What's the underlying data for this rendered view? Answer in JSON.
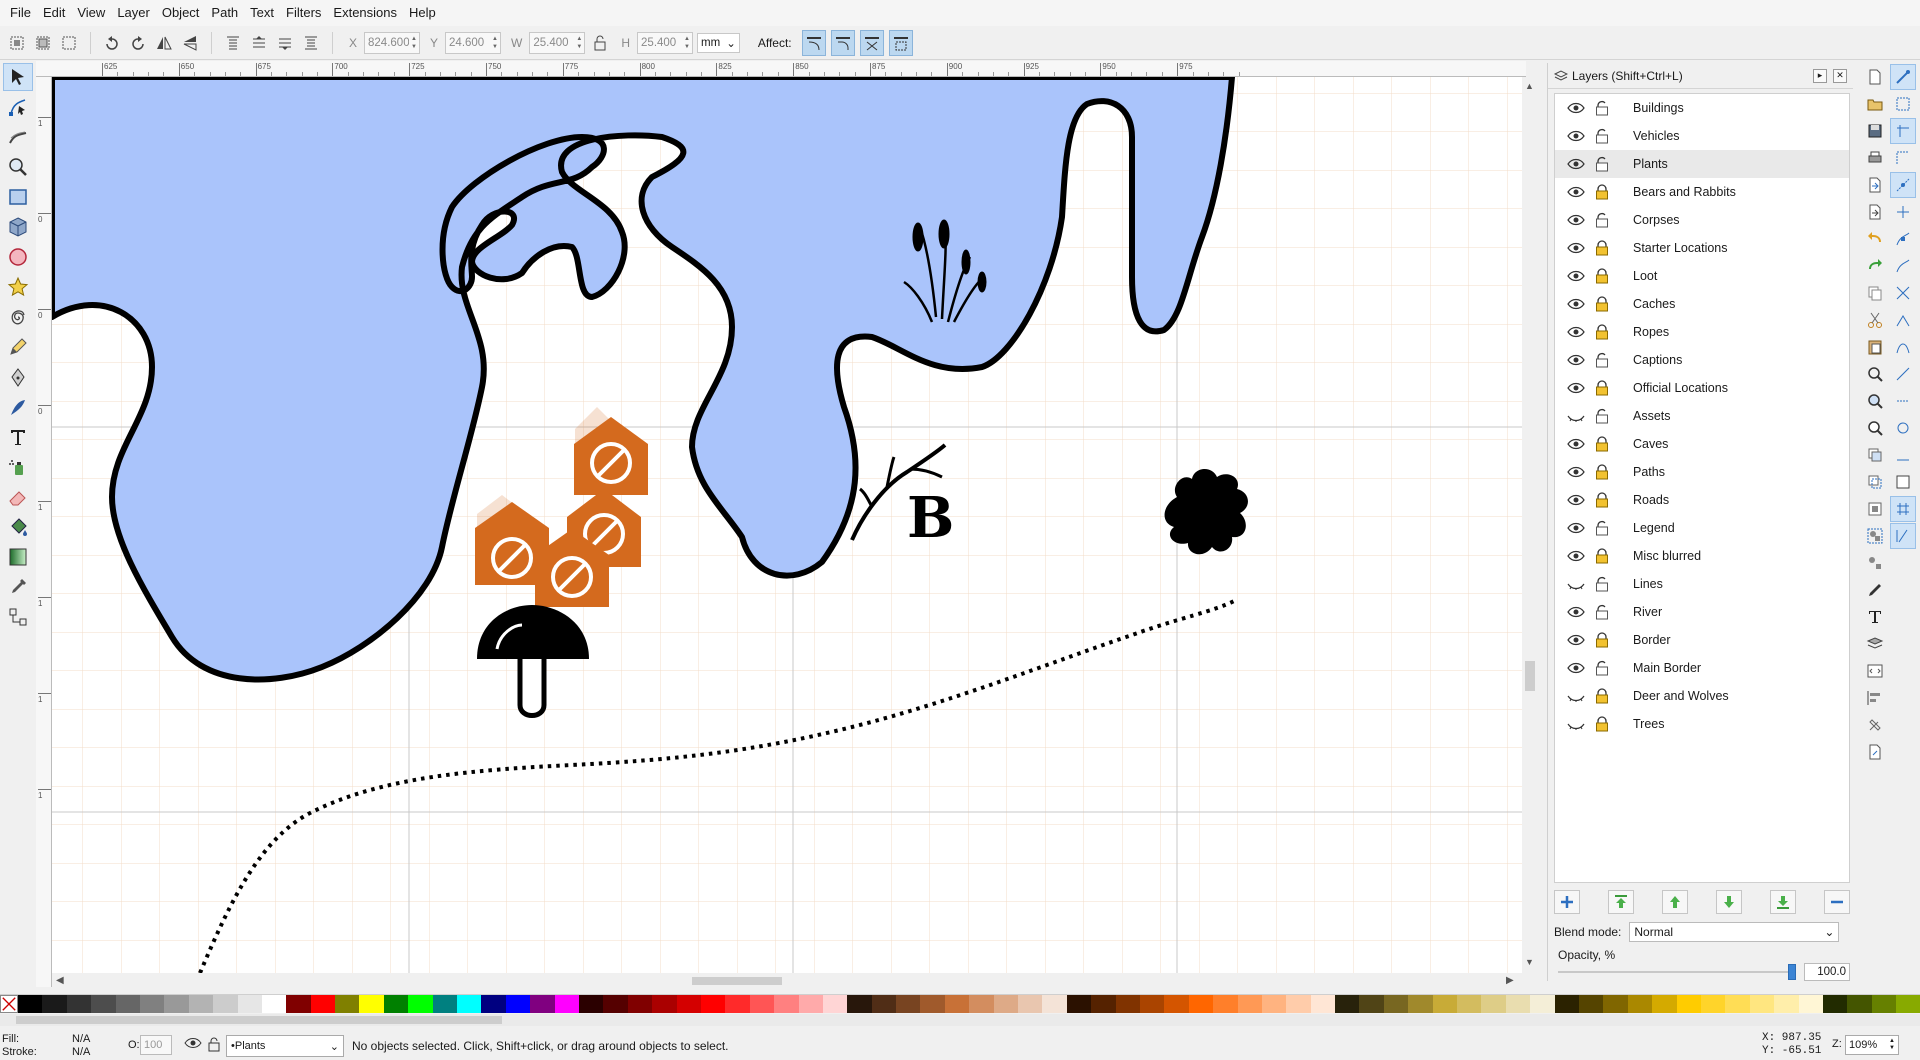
{
  "menu": [
    "File",
    "Edit",
    "View",
    "Layer",
    "Object",
    "Path",
    "Text",
    "Filters",
    "Extensions",
    "Help"
  ],
  "toolctrl": {
    "x_label": "X",
    "x_value": "824.600",
    "y_label": "Y",
    "y_value": "24.600",
    "w_label": "W",
    "w_value": "25.400",
    "h_label": "H",
    "h_value": "25.400",
    "unit": "mm",
    "affect_label": "Affect:"
  },
  "ruler_top": [
    "625",
    "650",
    "675",
    "700",
    "725",
    "750",
    "775",
    "800",
    "825",
    "850",
    "875",
    "900",
    "925",
    "950",
    "975"
  ],
  "ruler_left": [
    "1",
    "0",
    "0",
    "0",
    "1",
    "1",
    "1",
    "1"
  ],
  "canvas": {
    "marker_letter": "B"
  },
  "layers": {
    "title": "Layers (Shift+Ctrl+L)",
    "items": [
      {
        "name": "Buildings",
        "visible": true,
        "locked": false
      },
      {
        "name": "Vehicles",
        "visible": true,
        "locked": false
      },
      {
        "name": "Plants",
        "visible": true,
        "locked": false,
        "selected": true
      },
      {
        "name": "Bears and Rabbits",
        "visible": true,
        "locked": true
      },
      {
        "name": "Corpses",
        "visible": true,
        "locked": false
      },
      {
        "name": "Starter Locations",
        "visible": true,
        "locked": true
      },
      {
        "name": "Loot",
        "visible": true,
        "locked": true
      },
      {
        "name": "Caches",
        "visible": true,
        "locked": true
      },
      {
        "name": "Ropes",
        "visible": true,
        "locked": true
      },
      {
        "name": "Captions",
        "visible": true,
        "locked": false
      },
      {
        "name": "Official Locations",
        "visible": true,
        "locked": true
      },
      {
        "name": "Assets",
        "visible": false,
        "locked": false
      },
      {
        "name": "Caves",
        "visible": true,
        "locked": true
      },
      {
        "name": "Paths",
        "visible": true,
        "locked": true
      },
      {
        "name": "Roads",
        "visible": true,
        "locked": true
      },
      {
        "name": "Legend",
        "visible": true,
        "locked": false
      },
      {
        "name": "Misc blurred",
        "visible": true,
        "locked": true
      },
      {
        "name": "Lines",
        "visible": false,
        "locked": false
      },
      {
        "name": "River",
        "visible": true,
        "locked": false
      },
      {
        "name": "Border",
        "visible": true,
        "locked": true
      },
      {
        "name": "Main Border",
        "visible": true,
        "locked": false
      },
      {
        "name": "Deer and Wolves",
        "visible": false,
        "locked": true
      },
      {
        "name": "Trees",
        "visible": false,
        "locked": true
      }
    ],
    "blend_label": "Blend mode:",
    "blend_value": "Normal",
    "opacity_label": "Opacity, %",
    "opacity_value": "100.0"
  },
  "palette": [
    "#000000",
    "#1a1a1a",
    "#333333",
    "#4d4d4d",
    "#666666",
    "#808080",
    "#999999",
    "#b3b3b3",
    "#cccccc",
    "#e6e6e6",
    "#ffffff",
    "#800000",
    "#ff0000",
    "#808000",
    "#ffff00",
    "#008000",
    "#00ff00",
    "#008080",
    "#00ffff",
    "#000080",
    "#0000ff",
    "#800080",
    "#ff00ff",
    "#2b0000",
    "#550000",
    "#800000",
    "#aa0000",
    "#d40000",
    "#ff0000",
    "#ff2a2a",
    "#ff5555",
    "#ff8080",
    "#ffaaaa",
    "#ffd5d5",
    "#28170b",
    "#502d16",
    "#784421",
    "#a05a2c",
    "#c87137",
    "#d38d5f",
    "#deaa87",
    "#e9c6af",
    "#f4e3d7",
    "#2b1100",
    "#552200",
    "#803300",
    "#aa4400",
    "#d45500",
    "#ff6600",
    "#ff7f2a",
    "#ff9955",
    "#ffb380",
    "#ffccaa",
    "#ffe6d5",
    "#28220b",
    "#504416",
    "#786721",
    "#a0892c",
    "#c8ab37",
    "#d3bc5f",
    "#decd87",
    "#e9ddaf",
    "#f4eed7",
    "#2b2200",
    "#554400",
    "#806600",
    "#aa8800",
    "#d4aa00",
    "#ffcc00",
    "#ffd42a",
    "#ffdd55",
    "#ffe680",
    "#ffeeaa",
    "#fff6d5",
    "#222b00",
    "#445500",
    "#668000",
    "#88aa00"
  ],
  "status": {
    "fill_label": "Fill:",
    "fill_value": "N/A",
    "stroke_label": "Stroke:",
    "stroke_value": "N/A",
    "opacity_label": "O:",
    "opacity_value": "100",
    "layer_value": "•Plants",
    "message": "No objects selected. Click, Shift+click, or drag around objects to select.",
    "x_coord": "X:  987.35",
    "y_coord": "Y:  -65.51",
    "zoom_label": "Z:",
    "zoom_value": "109%"
  }
}
